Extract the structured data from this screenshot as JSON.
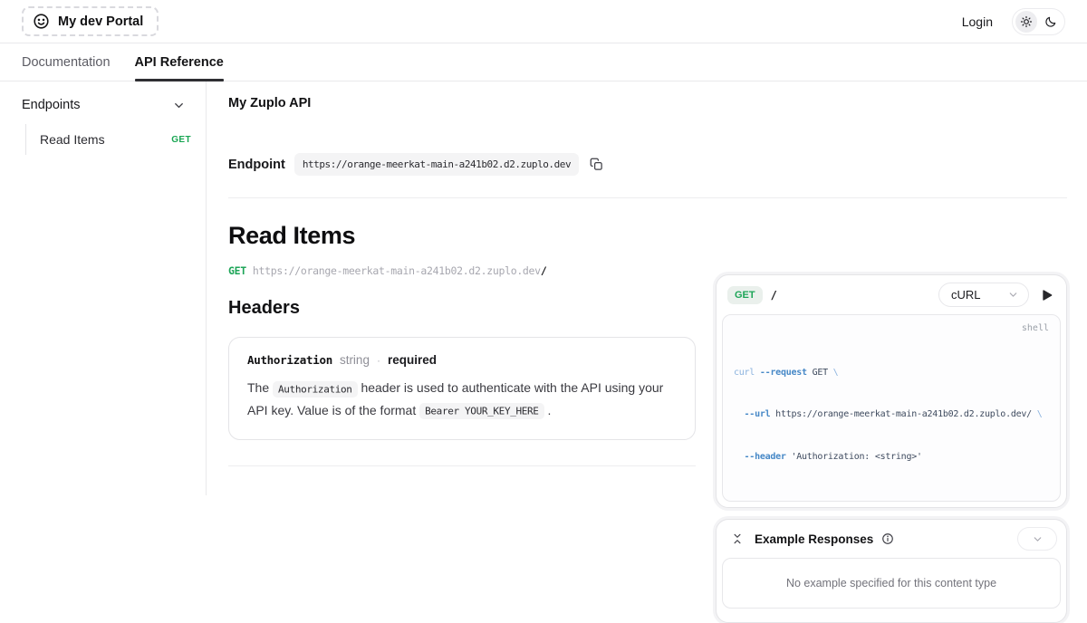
{
  "header": {
    "logo_text": "My dev Portal",
    "login_label": "Login"
  },
  "tabs": [
    {
      "label": "Documentation"
    },
    {
      "label": "API Reference"
    }
  ],
  "sidebar": {
    "section_label": "Endpoints",
    "items": [
      {
        "label": "Read Items",
        "method": "GET"
      }
    ]
  },
  "main": {
    "api_title": "My Zuplo API",
    "endpoint_label": "Endpoint",
    "endpoint_url": "https://orange-meerkat-main-a241b02.d2.zuplo.dev",
    "operation": {
      "title": "Read Items",
      "method": "GET",
      "base_url": "https://orange-meerkat-main-a241b02.d2.zuplo.dev",
      "path": "/"
    },
    "headers_section": {
      "title": "Headers",
      "param": {
        "name": "Authorization",
        "type": "string",
        "separator": "·",
        "required_label": "required",
        "desc_pre": "The",
        "desc_code1": "Authorization",
        "desc_mid": "header is used to authenticate with the API using your API key. Value is of the format",
        "desc_code2": "Bearer YOUR_KEY_HERE",
        "desc_post": "."
      }
    }
  },
  "playground": {
    "method": "GET",
    "path": "/",
    "language_selected": "cURL",
    "code_label": "shell",
    "code": {
      "t_curl": "curl ",
      "t_request_flag": "--request",
      "t_get": " GET ",
      "t_bs1": "\\",
      "t_url_flag": "  --url",
      "t_url": " https://orange-meerkat-main-a241b02.d2.zuplo.dev/ ",
      "t_bs2": "\\",
      "t_header_flag": "  --header",
      "t_header_val": " 'Authorization: <string>'"
    }
  },
  "responses": {
    "title": "Example Responses",
    "empty_message": "No example specified for this content type"
  },
  "colors": {
    "accent_green": "#1ea558",
    "badge_background": "#eaf0ec",
    "flag_blue": "#4688c7",
    "light_blue": "#8ab2de",
    "muted_gray": "#a7a7af"
  }
}
